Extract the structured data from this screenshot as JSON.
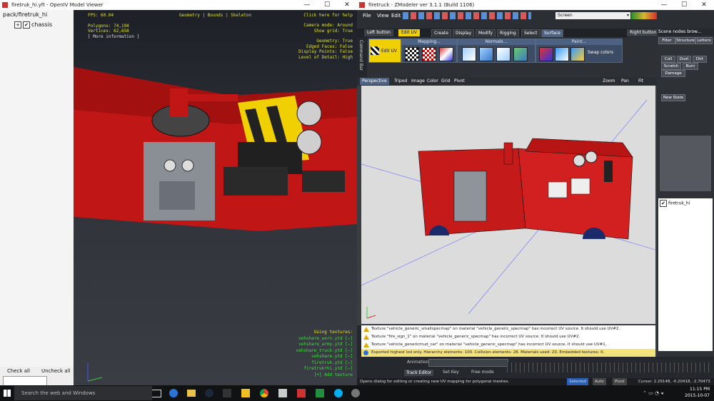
{
  "openiv": {
    "title": "firetruk_hi.yft - OpenIV Model Viewer",
    "tree": [
      {
        "label": "pack/firetruk_hi"
      },
      {
        "label": "chassis"
      }
    ],
    "hud_left": [
      "FPS: 60.04",
      "Polygons: 74,194",
      "Vertices: 62,658",
      "[ More information ]"
    ],
    "hud_tabs": "Geometry | Bounds | Skeleton",
    "hud_help": "Click here for help",
    "hud_right": [
      "Camera mode: Around",
      "Show grid: True",
      "",
      "Geometry: True",
      "Edged Faces: False",
      "Display Points: False",
      "Level of Detail: High"
    ],
    "textures_title": "Using textures:",
    "textures": [
      "vehshare_worn.ytd [−]",
      "vehshare_army.ytd [−]",
      "vehshare_truck.ytd [−]",
      "vehshare.ytd [−]",
      "firetruk.ytd [−]",
      "firetruk+hi.ytd [−]",
      "[+] Add texture"
    ],
    "check_all": "Check all",
    "uncheck_all": "Uncheck all"
  },
  "zmodeler": {
    "title": "firetruck - ZModeler ver 3.1.1 (Build 1106)",
    "menus": [
      "File",
      "View",
      "Edit"
    ],
    "screen_select": "Screen",
    "left_button": "Left button",
    "edit_uv_chip": "Edit UV",
    "right_button": "Right button",
    "side_label": "Command Bar",
    "tabs": [
      "Create",
      "Display",
      "Modify",
      "Rigging",
      "Select",
      "Surface"
    ],
    "groups": {
      "mapping": "Mapping...",
      "normals": "Normals...",
      "paint": "Paint..."
    },
    "edit_uv": "Edit UV",
    "swap_colors": "Swap colors",
    "viewport_menu": [
      "Perspective",
      "Tripod",
      "Image",
      "Color",
      "Grid",
      "Pivot"
    ],
    "zoom": "Zoom",
    "pan": "Pan",
    "fit": "Fit",
    "scene_nodes": "Scene nodes brow...",
    "right_tabs": [
      "Filter",
      "Structure",
      "Letters"
    ],
    "right_buttons": [
      "Coll",
      "Dust",
      "Dirt",
      "Scratch",
      "Burn",
      "Damage"
    ],
    "new_state": "New State",
    "scene_item": "firetruk_hi",
    "log": [
      {
        "type": "warn",
        "text": "Texture \"vehicle_generic_smallspecmap\" on material \"vehicle_generic_specmap\" has incorrect UV source. It should use UV#2."
      },
      {
        "type": "warn",
        "text": "Texture \"fire_sign_1\" on material \"vehicle_generic_specmap\" has incorrect UV source. It should use UV#2."
      },
      {
        "type": "warn",
        "text": "Texture \"vehicle_genericmud_car\" on material \"vehicle_generic_specmap\" has incorrect UV source. It should use UV#1."
      },
      {
        "type": "info",
        "text": "Exported highest lod only. Hierarchy elements: 100. Collision elements: 28. Materials used: 20. Embedded textures: 0."
      }
    ],
    "messages_label": "Messages",
    "animation_label": "Animation",
    "track_editor": "Track Editor",
    "set_key": "Set Key",
    "free_mode": "Free mode",
    "status_hint": "Opens dialog for editing or creating new UV mapping for polygonal meshes.",
    "selected": "Selected",
    "auto": "Auto",
    "pivot": "Pivot",
    "cursor": "Cursor: 2.29148, -0.20418, -2.70473"
  },
  "taskbar": {
    "search": "Search the web and Windows",
    "time": "11:15 PM",
    "date": "2015-10-07"
  },
  "colors": {
    "accent_red": "#d01818",
    "hud_yellow": "#e0e020",
    "hud_green": "#3ede3e",
    "ribbon_blue": "#3b4c64"
  }
}
